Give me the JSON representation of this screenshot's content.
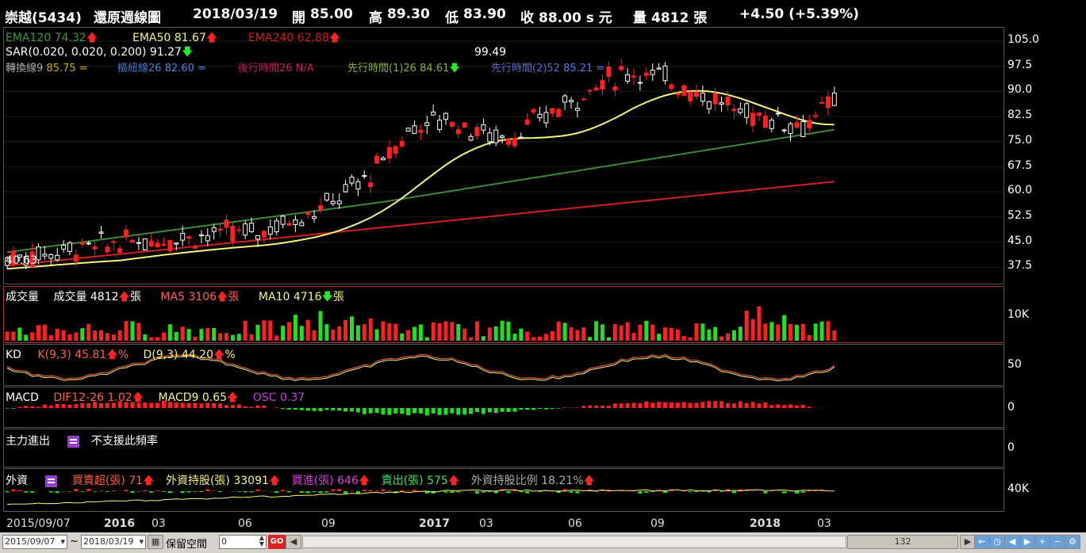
{
  "header": {
    "stock": "崇越(5434)",
    "chart_name": "還原週線圖",
    "date": "2018/03/19",
    "open_label": "開",
    "open": "85.00",
    "high_label": "高",
    "high": "89.30",
    "low_label": "低",
    "low": "83.90",
    "close_label": "收",
    "close": "88.00 s 元",
    "volume_label": "量",
    "volume": "4812 張",
    "change": "+4.50 (+5.39%)"
  },
  "main": {
    "ema120": "EMA120 74.32",
    "ema50": "EMA50 81.67",
    "ema240": "EMA240 62.88",
    "sar": "SAR(0.020, 0.020, 0.200) 91.27",
    "conv": "轉換線9",
    "conv_val": "85.75 =",
    "base": "樞紐線26",
    "base_val": "82.60 =",
    "lag": "後行時間26",
    "lag_val": "N/A",
    "lead1": "先行時間(1)26",
    "lead1_val": "84.61",
    "lead2": "先行時間(2)52",
    "lead2_val": "85.21 =",
    "peak_label": "99.49",
    "low_label": "40.63",
    "y_ticks": [
      "105.0",
      "97.5",
      "90.0",
      "82.5",
      "75.0",
      "67.5",
      "60.0",
      "52.5",
      "45.0",
      "37.5"
    ]
  },
  "volume": {
    "title": "成交量",
    "vol": "成交量 4812",
    "vol_unit": "張",
    "ma5": "MA5 3106",
    "ma5_unit": "張",
    "ma10": "MA10 4716",
    "ma10_unit": "張",
    "axis": "10K"
  },
  "kd": {
    "title": "KD",
    "k": "K(9,3) 45.81",
    "k_unit": "%",
    "d": "D(9,3) 44.20",
    "d_unit": "%",
    "axis": "50"
  },
  "macd": {
    "title": "MACD",
    "dif": "DIF12-26 1.02",
    "macd9": "MACD9 0.65",
    "osc": "OSC 0.37",
    "axis": "0"
  },
  "main_force": {
    "title": "主力進出",
    "msg": "不支援此頻率",
    "axis": "0"
  },
  "foreign": {
    "title": "外資",
    "net": "買賣超(張) 71",
    "hold": "外資持股(張) 33091",
    "buy": "買進(張) 646",
    "sell": "賣出(張) 575",
    "ratio": "外資持股比例 18.21%",
    "axis": "40K"
  },
  "x_axis": {
    "ticks": [
      "2015/09/07",
      "2016",
      "03",
      "06",
      "09",
      "2017",
      "03",
      "06",
      "09",
      "2018",
      "03"
    ]
  },
  "bottom": {
    "start_date": "2015/09/07",
    "tilde": "~",
    "end_date": "2018/03/19",
    "reserve_label": "保留空間",
    "reserve_value": "0",
    "go": "GO",
    "scroll_value": "132"
  },
  "colors": {
    "up": "#ff2020",
    "down": "#20e020",
    "ema120": "#3a8a3a",
    "ema50": "#f4f47a",
    "ema240": "#d02020"
  }
}
